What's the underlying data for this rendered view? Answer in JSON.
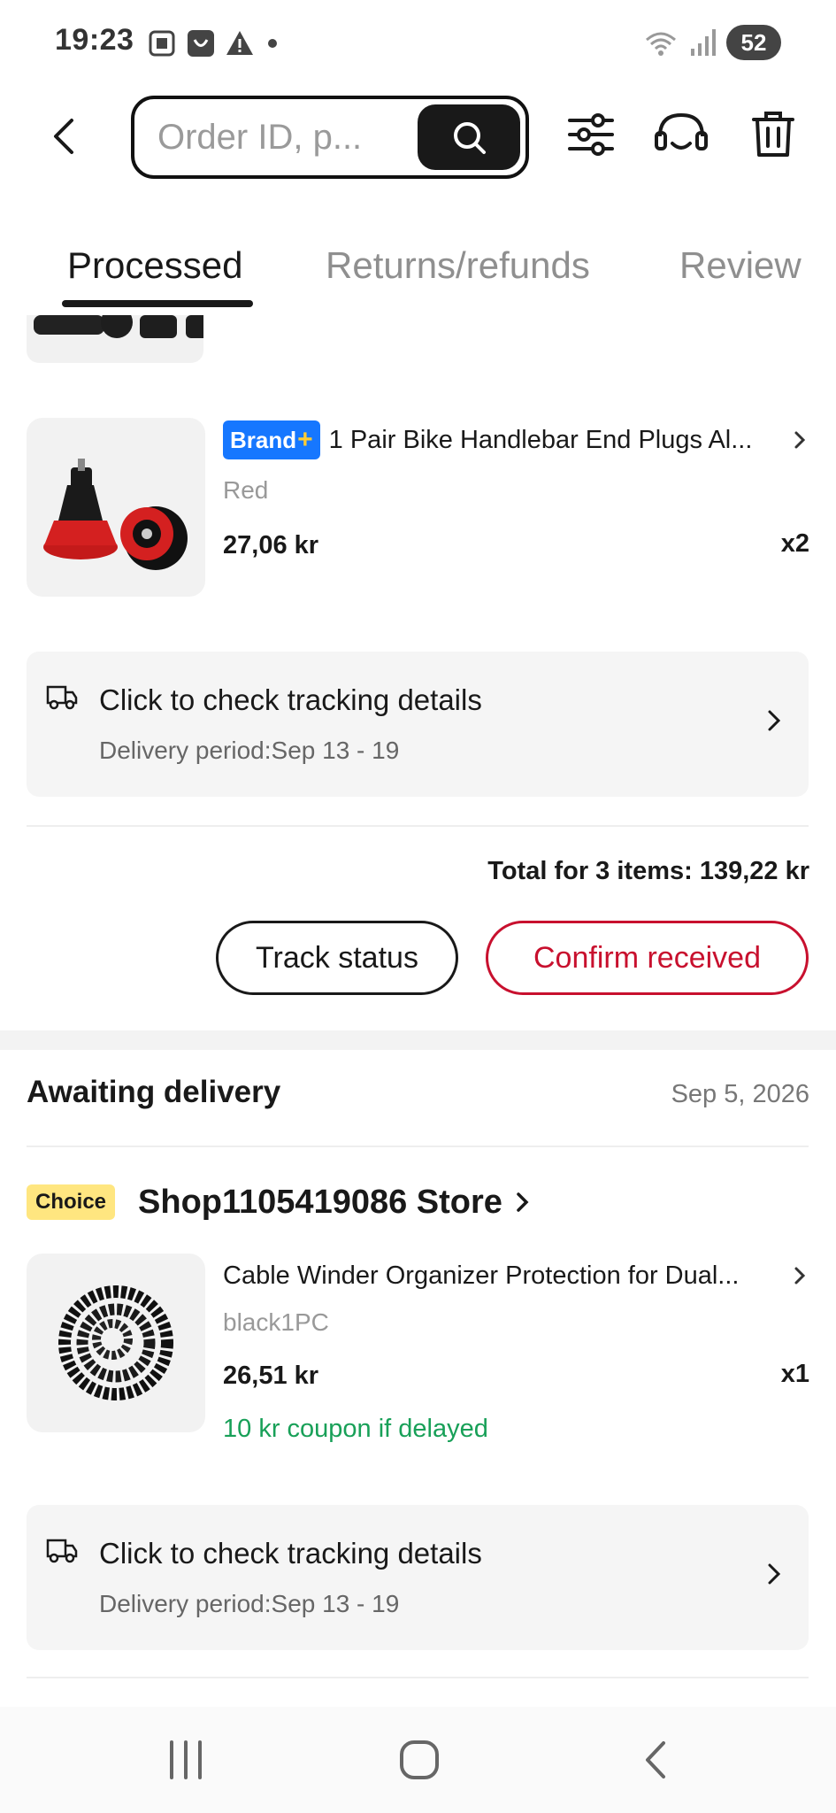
{
  "status_bar": {
    "time": "19:23",
    "battery": "52"
  },
  "search": {
    "placeholder": "Order ID, p..."
  },
  "tabs": [
    {
      "label": "Processed",
      "active": true
    },
    {
      "label": "Returns/refunds",
      "active": false
    },
    {
      "label": "Review",
      "active": false
    }
  ],
  "order1": {
    "product": {
      "badge_text": "Brand",
      "badge_plus": "+",
      "title": "1 Pair Bike Handlebar End Plugs Al...",
      "variant": "Red",
      "price": "27,06 kr",
      "qty": "x2"
    },
    "tracking": {
      "title": "Click to check tracking details",
      "subtitle": "Delivery period:Sep 13 - 19"
    },
    "total": "Total for 3 items: 139,22 kr",
    "buttons": {
      "track": "Track status",
      "confirm": "Confirm received"
    }
  },
  "order2": {
    "status": "Awaiting delivery",
    "date": "Sep 5, 2026",
    "store": {
      "badge": "Choice",
      "name": "Shop1105419086 Store"
    },
    "product": {
      "title": "Cable Winder Organizer Protection for Dual...",
      "variant": "black1PC",
      "price": "26,51 kr",
      "qty": "x1",
      "coupon": "10 kr coupon if delayed"
    },
    "tracking": {
      "title": "Click to check tracking details",
      "subtitle": "Delivery period:Sep 13 - 19"
    }
  },
  "colors": {
    "brand_blue": "#1677ff",
    "confirm_red": "#c8102e",
    "coupon_green": "#18a058",
    "choice_yellow": "#ffe680"
  },
  "icons": [
    "back-icon",
    "search-icon",
    "filter-icon",
    "support-headset-icon",
    "trash-icon",
    "truck-icon",
    "chevron-right-icon",
    "nav-recents-icon",
    "nav-home-icon",
    "nav-back-icon"
  ]
}
